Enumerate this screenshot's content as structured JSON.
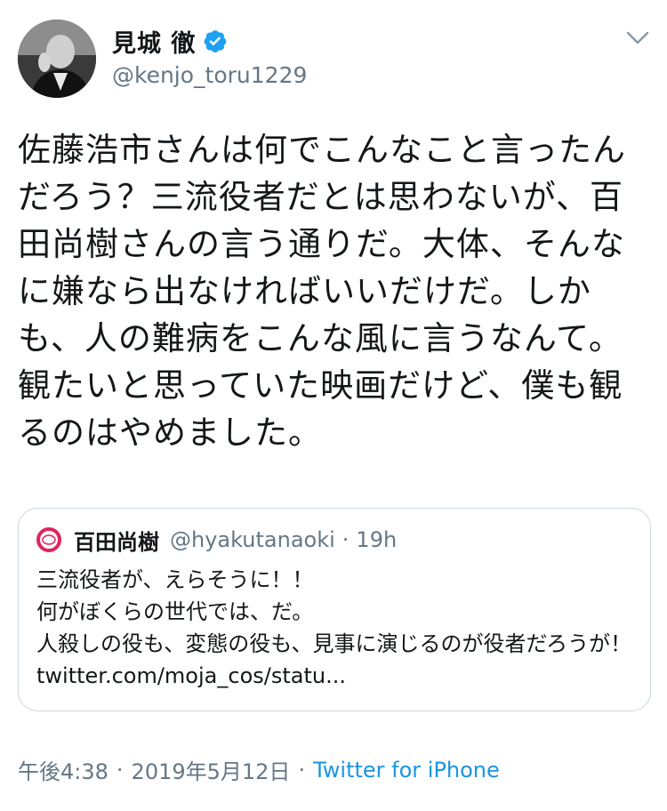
{
  "author": {
    "name": "見城 徹",
    "handle": "@kenjo_toru1229",
    "verified": true
  },
  "tweet": {
    "text": "佐藤浩市さんは何でこんなこと言ったんだろう？三流役者だとは思わないが、百田尚樹さんの言う通りだ。大体、そんなに嫌なら出なければいいだけだ。しかも、人の難病をこんな風に言うなんて。観たいと思っていた映画だけど、僕も観るのはやめました。"
  },
  "quoted": {
    "name": "百田尚樹",
    "handle": "@hyakutanaoki",
    "separator": "·",
    "time": "19h",
    "text": "三流役者が、えらそうに！！\n何がぼくらの世代では、だ。\n人殺しの役も、変態の役も、見事に演じるのが役者だろうが！ twitter.com/moja_cos/statu..."
  },
  "meta": {
    "time": "午後4:38",
    "separator": "·",
    "date": "2019年5月12日",
    "source": "Twitter for iPhone"
  },
  "colors": {
    "verified": "#1da1f2",
    "link": "#1b95e0",
    "muted": "#657786",
    "quote_avatar_ring": "#e0245e"
  },
  "icons": {
    "verified": "verified-badge-icon",
    "menu": "chevron-down-icon",
    "quote_avatar": "circle-logo-icon"
  }
}
